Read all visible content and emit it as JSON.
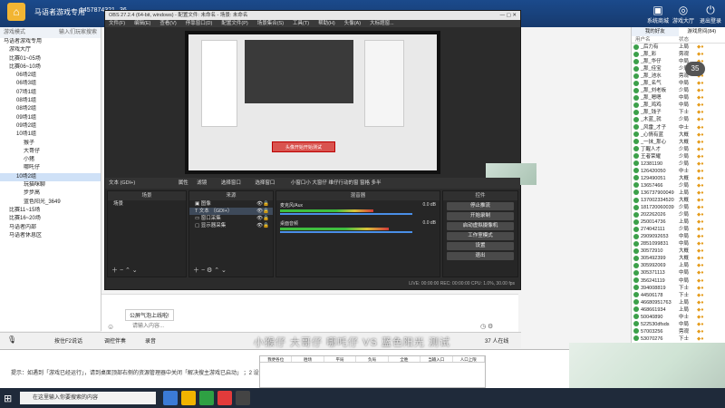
{
  "app": {
    "title": "马语者游戏专用",
    "user_id": "1457874321",
    "level": "36",
    "top_icons": [
      {
        "label": "",
        "icon": "gift-icon"
      },
      {
        "label": "",
        "icon": "mail-icon"
      },
      {
        "label": "",
        "icon": "shop-icon"
      }
    ],
    "right_top_labels": [
      "系统商城",
      "游戏大厅",
      "退出登录"
    ],
    "room_number": "23914386"
  },
  "left_panel": {
    "header": "游戏模式",
    "header_right": "输入们玩家搜索",
    "items": [
      {
        "label": "马语者游戏专用",
        "level": 0
      },
      {
        "label": "游戏大厅",
        "level": 1
      },
      {
        "label": "比赛01~05场",
        "level": 1
      },
      {
        "label": "比赛06~10场",
        "level": 1
      },
      {
        "label": "06场2组",
        "level": 2
      },
      {
        "label": "06场3组",
        "level": 2
      },
      {
        "label": "07场1组",
        "level": 2
      },
      {
        "label": "08场1组",
        "level": 2
      },
      {
        "label": "08场2组",
        "level": 2
      },
      {
        "label": "09场1组",
        "level": 2
      },
      {
        "label": "09场2组",
        "level": 2
      },
      {
        "label": "10场1组",
        "level": 2
      },
      {
        "label": "猴子",
        "level": 3
      },
      {
        "label": "大哥仔",
        "level": 3
      },
      {
        "label": "小猪",
        "level": 3
      },
      {
        "label": "哪吒仔",
        "level": 3
      },
      {
        "label": "10场2组",
        "level": 2,
        "selected": true
      },
      {
        "label": "玩猫咪聊",
        "level": 3
      },
      {
        "label": "步步高",
        "level": 3
      },
      {
        "label": "蓝色阳光_3649",
        "level": 3
      },
      {
        "label": "比赛11~15场",
        "level": 1
      },
      {
        "label": "比赛16~20场",
        "level": 1
      },
      {
        "label": "马语者内部",
        "level": 1
      },
      {
        "label": "马语者休息区",
        "level": 1
      }
    ]
  },
  "obs": {
    "title": "OBS 27.2.4 (64-bit, windows) - 配置文件: 未命名 - 场景: 未命名",
    "menu": [
      "文件(F)",
      "编辑(E)",
      "查看(V)",
      "停靠窗口(D)",
      "配置文件(P)",
      "场景集合(S)",
      "工具(T)",
      "帮助(H)",
      "头像(A)",
      "大标题窗..."
    ],
    "preview_popup": "头像开始开始测试",
    "source_bar": {
      "properties": "属性",
      "filters": "滤镜",
      "select_window": "选择窗口",
      "display_capture": "选择窗口",
      "text": "小窗口小 大窗仔 维仔行动的窗 窗格 多半"
    },
    "text_source": "文本 (GDI+)",
    "scenes": {
      "title": "场景",
      "items": [
        "场景"
      ]
    },
    "sources": {
      "title": "来源",
      "items": [
        "图像",
        "文本 （GDI+）",
        "窗口采集",
        "显示器采集"
      ]
    },
    "mixer": {
      "title": "混音器",
      "tracks": [
        {
          "name": "麦克风/Aux",
          "db": "0.0 dB"
        },
        {
          "name": "桌面音频",
          "db": "0.0 dB"
        }
      ],
      "scale": "-60 -55 -50 -45 -40 -35 -30 -25 -20 -15 -10 -5 0"
    },
    "transitions": {
      "title": "场景过渡",
      "type": "淡出",
      "duration_label": "时长",
      "duration": "300 ms"
    },
    "controls": {
      "title": "控件",
      "buttons": [
        "停止推流",
        "开始录制",
        "启动虚拟摄像机",
        "工作室模式",
        "设置",
        "退出"
      ]
    },
    "status": "LIVE: 00:00:00   REC: 00:00:00   CPU: 1.0%, 30.00 fps"
  },
  "chat": {
    "notice": "公屏气泡上线啦!",
    "placeholder": "请输入内容...",
    "send_label": "发送"
  },
  "bottom_bar": {
    "items": [
      "按住F2说话",
      "调控伴奏",
      "录音"
    ],
    "room_count": "37",
    "room_suffix": "人在线"
  },
  "notice_text": "提示：如遇到「游戏已经运行」，请到桌面顶部右侧的资源管理器中关闭「解决搜主游戏已启动」 ；2 设计 文件",
  "sheet": {
    "headers": [
      "我更各位",
      "胜场",
      "平局",
      "负局",
      "全胜",
      "当输入口",
      "人口上限"
    ]
  },
  "overlay_text": "小猴仔 大哥仔 哪吒仔 VS 蓝色阳光 测试",
  "right_panel": {
    "tabs": [
      "我的好友",
      "游戏房间(84)"
    ],
    "header": "用户名",
    "status_col": "状态",
    "users": [
      {
        "name": "_后力有",
        "status": "上局"
      },
      {
        "name": "_那_彩",
        "status": "旁观"
      },
      {
        "name": "_那_华仔",
        "status": "中局"
      },
      {
        "name": "_那_佳宝",
        "status": "少局"
      },
      {
        "name": "_那_池水",
        "status": "旁观"
      },
      {
        "name": "_那_名气",
        "status": "中局"
      },
      {
        "name": "_那_刘老板",
        "status": "少局"
      },
      {
        "name": "_那_嗯嗯",
        "status": "中局"
      },
      {
        "name": "_那_鸡鸡",
        "status": "中局"
      },
      {
        "name": "_那_钱子",
        "status": "下士"
      },
      {
        "name": "_木蓝_就",
        "status": "少局"
      },
      {
        "name": "_风雷_才子",
        "status": "中士"
      },
      {
        "name": "_心情有蓝",
        "status": "大概"
      },
      {
        "name": "_一抹_那心",
        "status": "大概"
      },
      {
        "name": "丁醒人才",
        "status": "少局"
      },
      {
        "name": "王者荣耀",
        "status": "少局"
      },
      {
        "name": "12381190",
        "status": "少局"
      },
      {
        "name": "126420050",
        "status": "中士"
      },
      {
        "name": "129490051",
        "status": "大概"
      },
      {
        "name": "13657466",
        "status": "少局"
      },
      {
        "name": "136737900049",
        "status": "上局"
      },
      {
        "name": "137002334520",
        "status": "大概"
      },
      {
        "name": "181720060039",
        "status": "少局"
      },
      {
        "name": "202262026",
        "status": "少局"
      },
      {
        "name": "250014736",
        "status": "上局"
      },
      {
        "name": "274042111",
        "status": "少局"
      },
      {
        "name": "2909092653",
        "status": "中局"
      },
      {
        "name": "2851099831",
        "status": "中局"
      },
      {
        "name": "30572910",
        "status": "大概"
      },
      {
        "name": "305492399",
        "status": "大概"
      },
      {
        "name": "305992069",
        "status": "上局"
      },
      {
        "name": "305371113",
        "status": "中局"
      },
      {
        "name": "356241119",
        "status": "中局"
      },
      {
        "name": "394008819",
        "status": "下士"
      },
      {
        "name": "44506178",
        "status": "下士"
      },
      {
        "name": "46680951763",
        "status": "上局"
      },
      {
        "name": "468661934",
        "status": "上局"
      },
      {
        "name": "50040890",
        "status": "中士"
      },
      {
        "name": "522530dfsds",
        "status": "中局"
      },
      {
        "name": "57003256",
        "status": "旁观"
      },
      {
        "name": "53070276",
        "status": "下士"
      },
      {
        "name": "57900290",
        "status": "中局"
      },
      {
        "name": "672953919",
        "status": "大概"
      },
      {
        "name": "99535408",
        "status": "中局"
      },
      {
        "name": "99089808",
        "status": "大概"
      }
    ]
  },
  "taskbar": {
    "search_placeholder": "在这里输入你要搜索的内容"
  }
}
